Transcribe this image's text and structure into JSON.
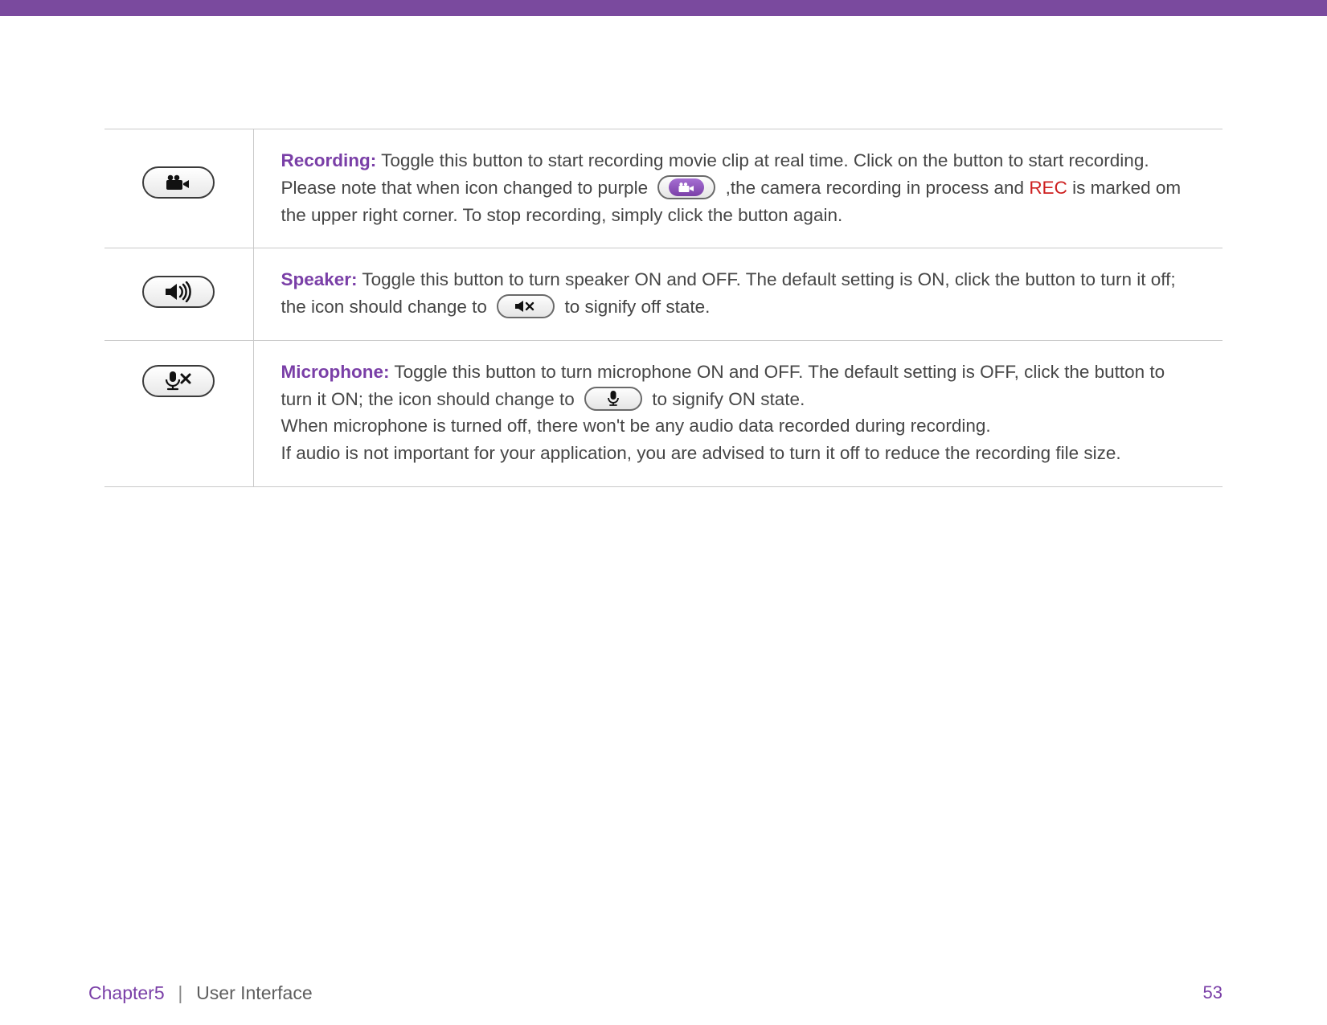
{
  "rows": {
    "recording": {
      "title": "Recording:",
      "text_a": " Toggle this button to start recording movie clip at real time. Click on the button to start recording. Please note that when icon changed to purple ",
      "text_b": " ,the camera recording in process and ",
      "rec_word": "REC",
      "text_c": " is marked om the upper right corner. To stop recording, simply click the button again."
    },
    "speaker": {
      "title": "Speaker:",
      "text_a": " Toggle this button to turn speaker ON and OFF. The default setting is ON, click the button to turn it off; the icon should change to ",
      "text_b": " to signify off state."
    },
    "microphone": {
      "title": "Microphone:",
      "text_a": " Toggle this button to turn microphone ON and OFF.  The default setting is OFF, click the button to turn it ON; the icon should change to ",
      "text_b": " to signify ON state.",
      "text_c": "When microphone is turned off, there won't be any audio data recorded during recording.",
      "text_d": "If audio is not important for your application, you are advised to turn it off to reduce the recording file size."
    }
  },
  "footer": {
    "chapter": "Chapter5",
    "section": "User Interface",
    "page": "53"
  }
}
